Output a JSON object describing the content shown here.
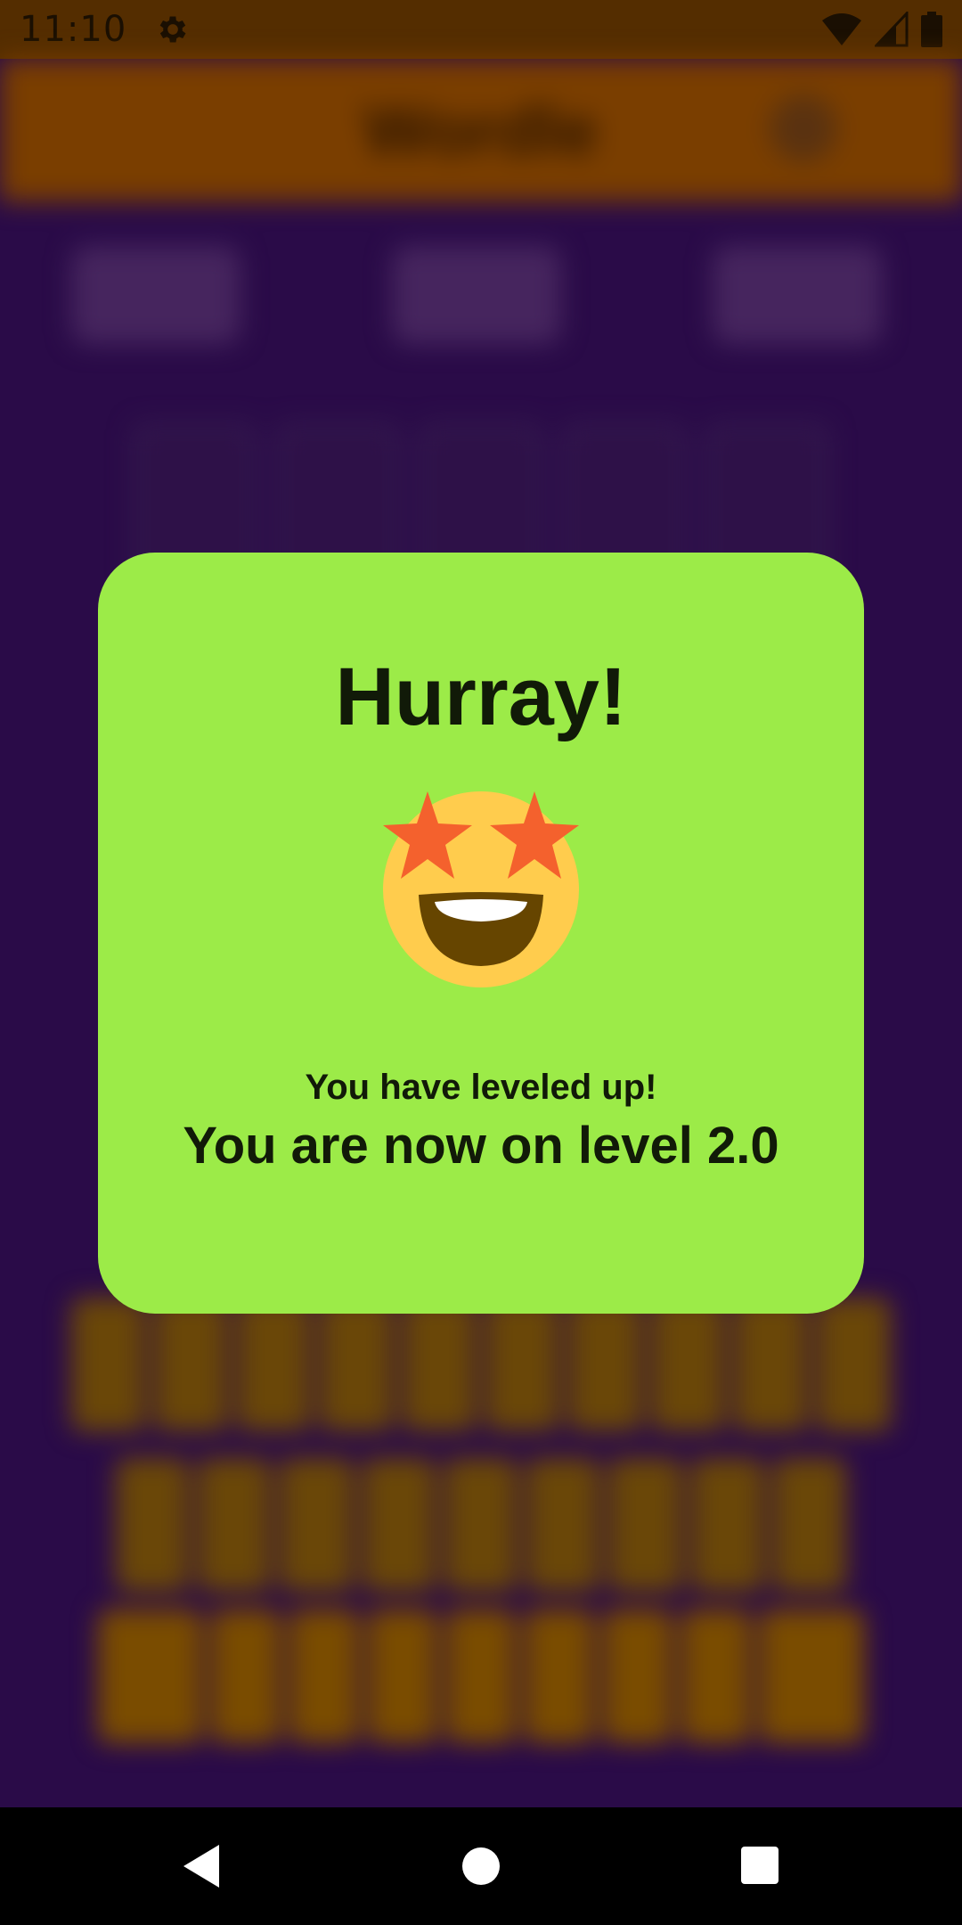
{
  "status_bar": {
    "time": "11:10",
    "icons": [
      "gear-icon",
      "wifi-icon",
      "signal-icon",
      "battery-icon"
    ]
  },
  "app": {
    "title": "Wordle"
  },
  "dialog": {
    "title": "Hurray!",
    "emoji": "star-struck-face",
    "subtitle": "You have leveled up!",
    "level_text": "You are now on level 2.0"
  },
  "nav_bar": {
    "icons": [
      "back-icon",
      "home-icon",
      "recents-icon"
    ]
  },
  "colors": {
    "dialog_bg": "#9ceb48",
    "app_bg": "#2a0b48",
    "header_bg": "#7a3e00",
    "key_bg": "#6a4708"
  }
}
